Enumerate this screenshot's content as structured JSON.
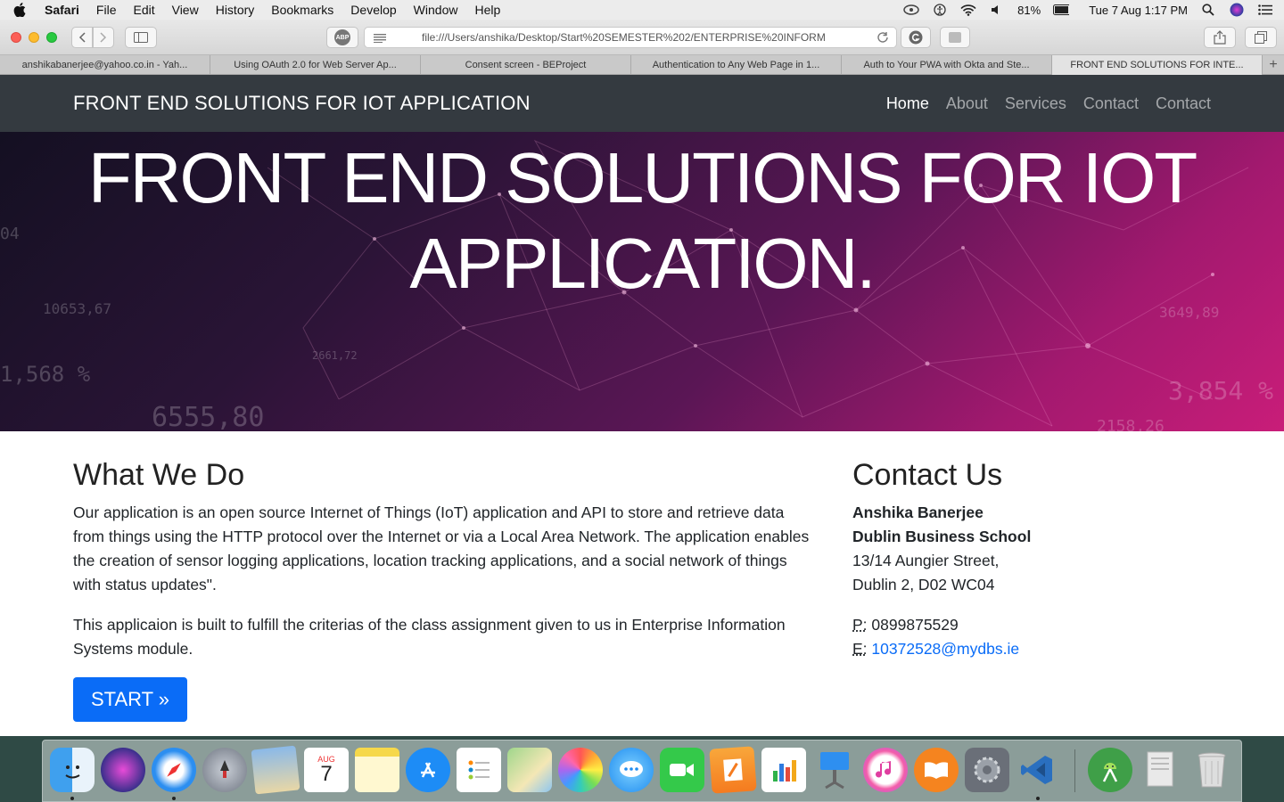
{
  "menubar": {
    "app": "Safari",
    "items": [
      "File",
      "Edit",
      "View",
      "History",
      "Bookmarks",
      "Develop",
      "Window",
      "Help"
    ],
    "battery": "81%",
    "datetime": "Tue 7 Aug  1:17 PM"
  },
  "toolbar": {
    "address": "file:///Users/anshika/Desktop/Start%20SEMESTER%202/ENTERPRISE%20INFORM",
    "abp_label": "ABP"
  },
  "tabs": [
    "anshikabanerjee@yahoo.co.in - Yah...",
    "Using OAuth 2.0 for Web Server Ap...",
    "Consent screen - BEProject",
    "Authentication to Any Web Page in 1...",
    "Auth to Your PWA with Okta and Ste...",
    "FRONT END SOLUTIONS FOR INTE..."
  ],
  "site": {
    "brand": "FRONT END SOLUTIONS FOR IOT APPLICATION",
    "nav": [
      "Home",
      "About",
      "Services",
      "Contact",
      "Contact"
    ],
    "hero_line1": "FRONT END SOLUTIONS FOR IOT",
    "hero_line2": "APPLICATION.",
    "what_title": "What We Do",
    "what_p1": "Our application is an open source Internet of Things (IoT) application and API to store and retrieve data from things using the HTTP protocol over the Internet or via a Local Area Network. The application enables the creation of sensor logging applications, location tracking applications, and a social network of things with status updates\".",
    "what_p2": "This applicaion is built to fulfill the criterias of the class assignment given to us in Enterprise Information Systems module.",
    "start_button": "START »",
    "contact_title": "Contact Us",
    "contact_name": "Anshika Banerjee",
    "contact_org": "Dublin Business School",
    "contact_street": "13/14 Aungier Street,",
    "contact_city": "Dublin 2, D02 WC04",
    "phone_label": "P:",
    "phone": "0899875529",
    "email_label": "E:",
    "email": "10372528@mydbs.ie"
  },
  "hero_bg_numbers": [
    "04",
    "10653,67",
    "1,568 %",
    "6555,80",
    "3649,89",
    "3,854 %",
    "2158,26",
    "2661,72"
  ],
  "dock": {
    "calendar_month": "AUG",
    "calendar_day": "7",
    "items": [
      "finder-icon",
      "siri-icon",
      "safari-icon",
      "launchpad-icon",
      "preview-icon",
      "calendar-icon",
      "notes-icon",
      "app-store-icon",
      "reminders-icon",
      "maps-icon",
      "photos-icon",
      "messages-icon",
      "facetime-icon",
      "pages-icon",
      "numbers-icon",
      "keynote-icon",
      "itunes-icon",
      "ibooks-icon",
      "system-preferences-icon",
      "vscode-icon",
      "android-studio-icon",
      "text-document-icon",
      "trash-icon"
    ]
  },
  "colors": {
    "navbar": "#343a40",
    "accent_blue": "#0a6cf7",
    "hero_pink": "#c91d79"
  }
}
